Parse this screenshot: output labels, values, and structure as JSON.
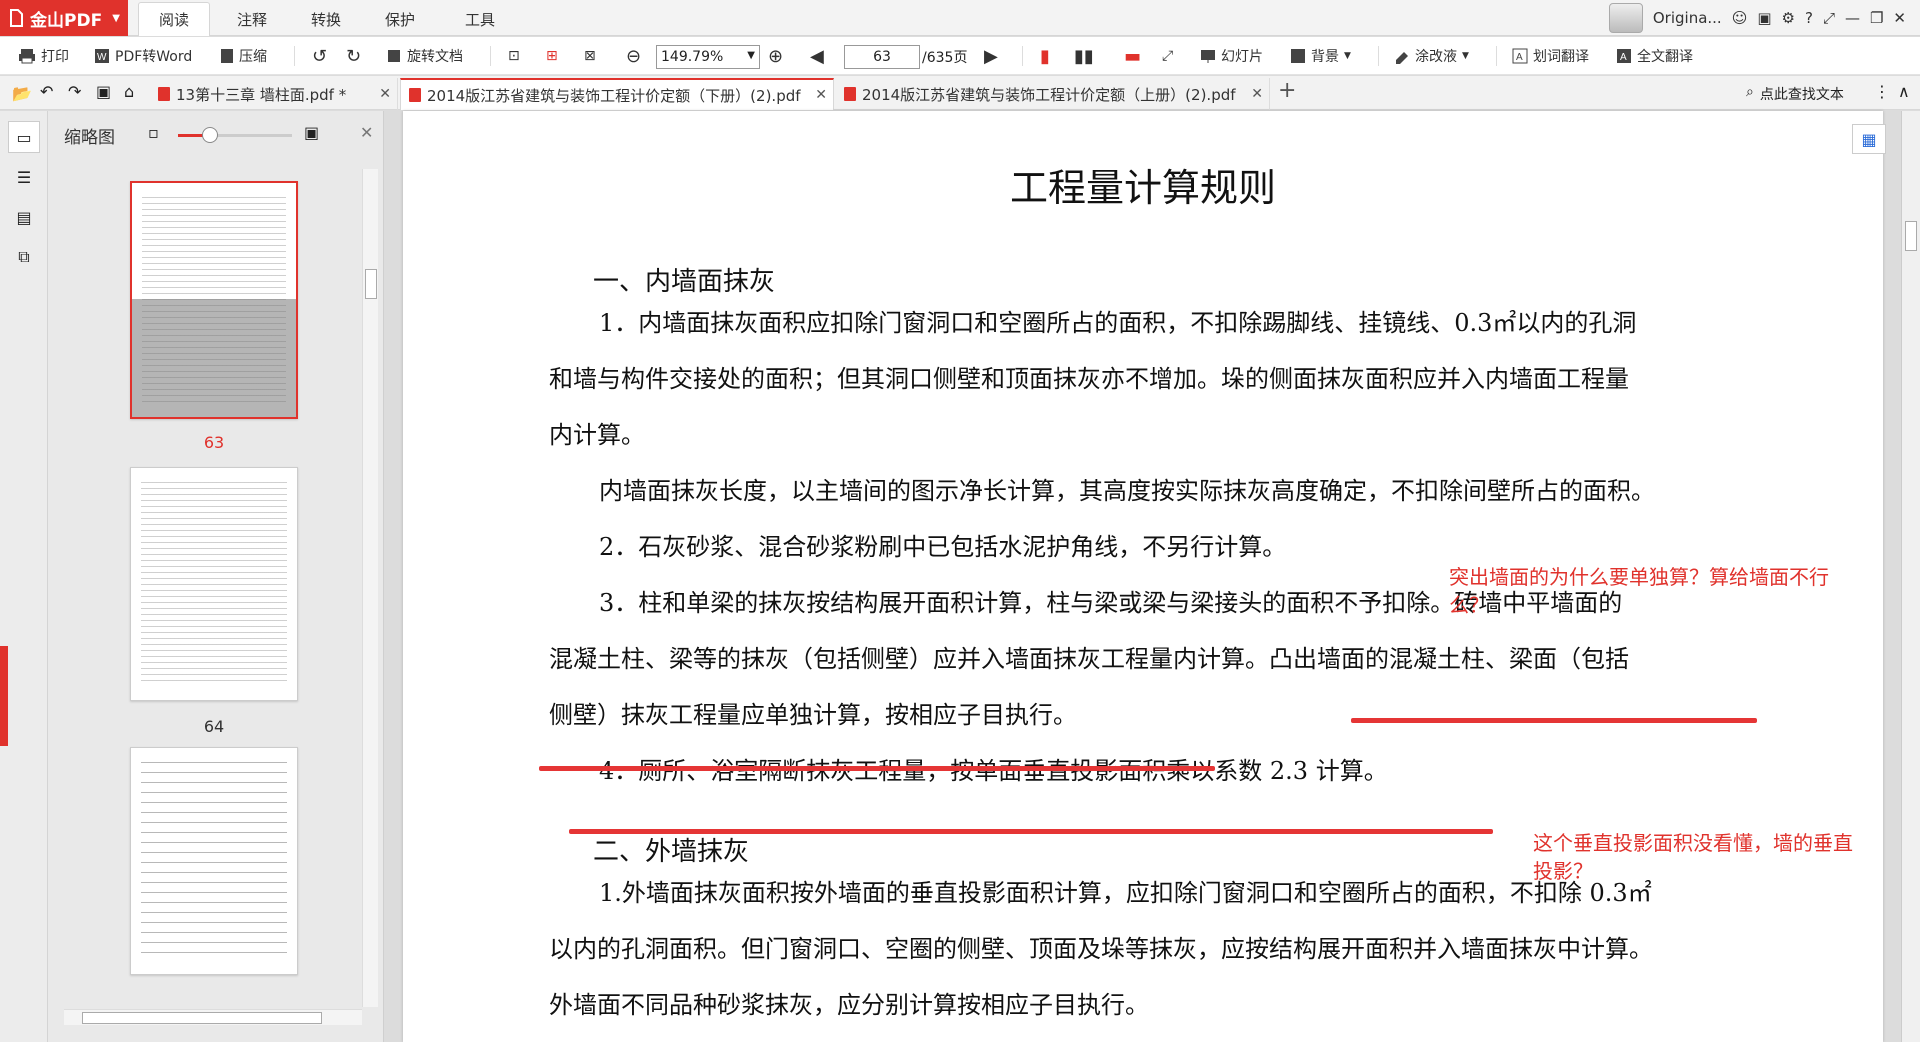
{
  "app": {
    "name": "金山PDF",
    "brand_color": "#e0322c",
    "user_name": "Origina..."
  },
  "menu_tabs": [
    "阅读",
    "注释",
    "转换",
    "保护",
    "工具"
  ],
  "toolbar": {
    "print": "打印",
    "pdf_to_word": "PDF转Word",
    "compress": "压缩",
    "rotate_doc": "旋转文档",
    "zoom": "149.79%",
    "page_current": "63",
    "page_total": "/635页",
    "slideshow": "幻灯片",
    "background": "背景",
    "correction": "涂改液",
    "word_translate": "划词翻译",
    "full_translate": "全文翻译"
  },
  "doc_tabs": [
    {
      "title": "13第十三章 墙柱面.pdf *"
    },
    {
      "title": "2014版江苏省建筑与装饰工程计价定额（下册）(2).pdf"
    },
    {
      "title": "2014版江苏省建筑与装饰工程计价定额（上册）(2).pdf"
    }
  ],
  "search_text": "点此查找文本",
  "thumb_panel": {
    "title": "缩略图",
    "pages": [
      "63",
      "64"
    ]
  },
  "page": {
    "title": "工程量计算规则",
    "h1": "一、内墙面抹灰",
    "lines": [
      "1．内墙面抹灰面积应扣除门窗洞口和空圈所占的面积，不扣除踢脚线、挂镜线、0.3㎡以内的孔洞",
      "和墙与构件交接处的面积；但其洞口侧壁和顶面抹灰亦不增加。垛的侧面抹灰面积应并入内墙面工程量",
      "内计算。",
      "内墙面抹灰长度，以主墙间的图示净长计算，其高度按实际抹灰高度确定，不扣除间壁所占的面积。",
      "2．石灰砂浆、混合砂浆粉刷中已包括水泥护角线，不另行计算。",
      "3．柱和单梁的抹灰按结构展开面积计算，柱与梁或梁与梁接头的面积不予扣除。砖墙中平墙面的",
      "混凝土柱、梁等的抹灰（包括侧壁）应并入墙面抹灰工程量内计算。凸出墙面的混凝土柱、梁面（包括",
      "侧壁）抹灰工程量应单独计算，按相应子目执行。",
      "4．厕所、浴室隔断抹灰工程量，按单面垂直投影面积乘以系数 2.3 计算。"
    ],
    "h2": "二、外墙抹灰",
    "lines2": [
      "1.外墙面抹灰面积按外墙面的垂直投影面积计算，应扣除门窗洞口和空圈所占的面积，不扣除 0.3㎡",
      "以内的孔洞面积。但门窗洞口、空圈的侧壁、顶面及垛等抹灰，应按结构展开面积并入墙面抹灰中计算。",
      "外墙面不同品种砂浆抹灰，应分别计算按相应子目执行。"
    ],
    "note1": [
      "突出墙面的为什么要单独算？算给墙面不行",
      "么？"
    ],
    "note2": [
      "这个垂直投影面积没看懂，墙的垂直",
      "投影？"
    ]
  }
}
